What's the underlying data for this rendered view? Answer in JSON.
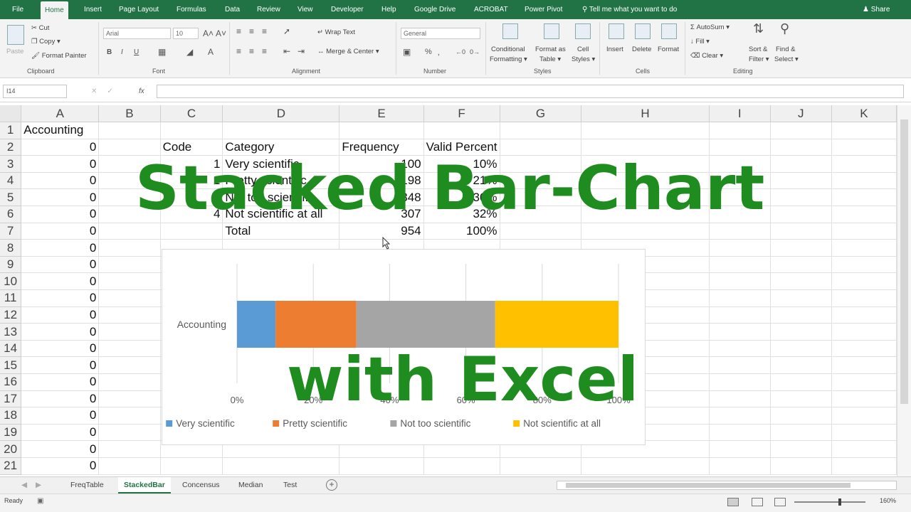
{
  "ribbon_tabs": [
    "File",
    "Home",
    "Insert",
    "Page Layout",
    "Formulas",
    "Data",
    "Review",
    "View",
    "Developer",
    "Help",
    "Google Drive",
    "ACROBAT",
    "Power Pivot"
  ],
  "active_tab": "Home",
  "tell_me": "Tell me what you want to do",
  "share": "Share",
  "clipboard": {
    "paste": "Paste",
    "cut": "Cut",
    "copy": "Copy",
    "format_painter": "Format Painter",
    "label": "Clipboard"
  },
  "font": {
    "name": "Arial",
    "size": "10",
    "label": "Font"
  },
  "alignment": {
    "wrap_text": "Wrap Text",
    "merge_center": "Merge & Center",
    "label": "Alignment"
  },
  "number": {
    "format": "General",
    "percent": "%",
    "label": "Number"
  },
  "styles": {
    "conditional": "Conditional",
    "formatting": "Formatting",
    "format_as": "Format as",
    "table": "Table",
    "cell": "Cell",
    "styles_word": "Styles",
    "label": "Styles"
  },
  "cells": {
    "insert": "Insert",
    "delete": "Delete",
    "format": "Format",
    "label": "Cells"
  },
  "editing": {
    "autosum": "AutoSum",
    "fill": "Fill",
    "clear": "Clear",
    "sort": "Sort &",
    "filter": "Filter",
    "find": "Find &",
    "select": "Select",
    "label": "Editing"
  },
  "formula_bar": {
    "name_box": "I14",
    "fx": "fx"
  },
  "columns": [
    "A",
    "B",
    "C",
    "D",
    "E",
    "F",
    "G",
    "H",
    "I",
    "J",
    "K"
  ],
  "rows": [
    {
      "n": "1",
      "a": "Accounting",
      "c": "",
      "d": "",
      "e": "",
      "f": ""
    },
    {
      "n": "2",
      "a": "0",
      "c": "Code",
      "d": "Category",
      "e": "Frequency",
      "f": "Valid Percent"
    },
    {
      "n": "3",
      "a": "0",
      "c": "1",
      "d": "Very scientific",
      "e": "100",
      "f": "10%"
    },
    {
      "n": "4",
      "a": "0",
      "c": "2",
      "d": "Pretty scientific",
      "e": "198",
      "f": "21%"
    },
    {
      "n": "5",
      "a": "0",
      "c": "3",
      "d": "Not too scientific",
      "e": "348",
      "f": "36%"
    },
    {
      "n": "6",
      "a": "0",
      "c": "4",
      "d": "Not scientific at all",
      "e": "307",
      "f": "32%"
    },
    {
      "n": "7",
      "a": "0",
      "c": "",
      "d": "Total",
      "e": "954",
      "f": "100%"
    },
    {
      "n": "8",
      "a": "0"
    },
    {
      "n": "9",
      "a": "0"
    },
    {
      "n": "10",
      "a": "0"
    },
    {
      "n": "11",
      "a": "0"
    },
    {
      "n": "12",
      "a": "0"
    },
    {
      "n": "13",
      "a": "0"
    },
    {
      "n": "14",
      "a": "0"
    },
    {
      "n": "15",
      "a": "0"
    },
    {
      "n": "16",
      "a": "0"
    },
    {
      "n": "17",
      "a": "0"
    },
    {
      "n": "18",
      "a": "0"
    },
    {
      "n": "19",
      "a": "0"
    },
    {
      "n": "20",
      "a": "0"
    },
    {
      "n": "21",
      "a": "0"
    }
  ],
  "overlay": {
    "line1": "Stacked Bar-Chart",
    "line2": "with Excel"
  },
  "chart_data": {
    "type": "bar",
    "orientation": "horizontal",
    "stacked": "100%",
    "categories": [
      "Accounting"
    ],
    "series": [
      {
        "name": "Very scientific",
        "values": [
          10
        ],
        "color": "#5b9bd5"
      },
      {
        "name": "Pretty scientific",
        "values": [
          21
        ],
        "color": "#ed7d31"
      },
      {
        "name": "Not too scientific",
        "values": [
          36
        ],
        "color": "#a5a5a5"
      },
      {
        "name": "Not scientific at all",
        "values": [
          32
        ],
        "color": "#ffc000"
      }
    ],
    "x_ticks": [
      "0%",
      "20%",
      "40%",
      "60%",
      "80%",
      "100%"
    ],
    "xlim": [
      0,
      100
    ],
    "grid": true,
    "legend": "bottom"
  },
  "sheet_tabs": [
    "FreqTable",
    "StackedBar",
    "Concensus",
    "Median",
    "Test"
  ],
  "active_sheet": "StackedBar",
  "status": {
    "ready": "Ready",
    "zoom": "160%"
  },
  "colors": {
    "excel_green": "#217346",
    "overlay_green": "#1f8c1f"
  }
}
